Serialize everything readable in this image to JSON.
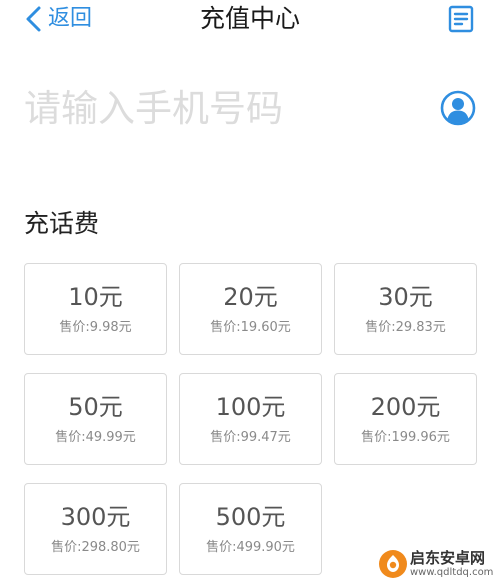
{
  "navbar": {
    "back_label": "返回",
    "title": "充值中心",
    "back_icon": "chevron-left-icon",
    "list_icon": "document-list-icon"
  },
  "phone": {
    "placeholder": "请输入手机号码",
    "value": "",
    "contact_icon": "contact-person-icon"
  },
  "section": {
    "title": "充话费"
  },
  "cards": [
    {
      "amount": "10元",
      "price": "售价:9.98元"
    },
    {
      "amount": "20元",
      "price": "售价:19.60元"
    },
    {
      "amount": "30元",
      "price": "售价:29.83元"
    },
    {
      "amount": "50元",
      "price": "售价:49.99元"
    },
    {
      "amount": "100元",
      "price": "售价:99.47元"
    },
    {
      "amount": "200元",
      "price": "售价:199.96元"
    },
    {
      "amount": "300元",
      "price": "售价:298.80元"
    },
    {
      "amount": "500元",
      "price": "售价:499.90元"
    }
  ],
  "watermark": {
    "title": "启东安卓网",
    "url": "www.qdltdq.com",
    "logo_icon": "watermark-logo-icon"
  },
  "colors": {
    "accent": "#2f8ee0",
    "card_border": "#d9d9d9",
    "amount_text": "#555555",
    "price_text": "#8a8a8a",
    "placeholder": "#dcdcdc"
  }
}
